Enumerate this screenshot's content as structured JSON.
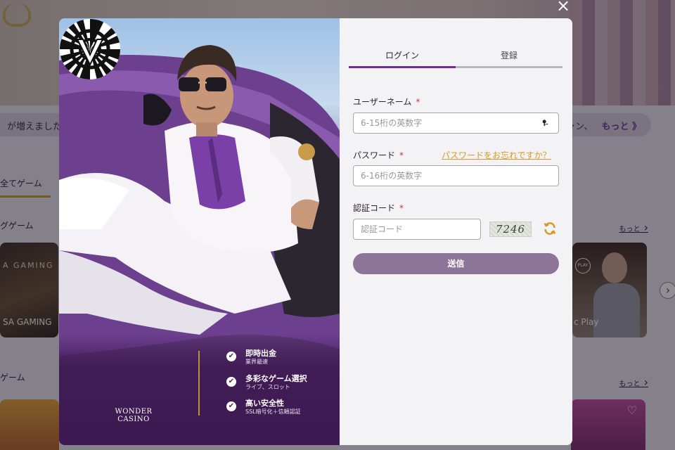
{
  "background": {
    "ticker_left": "が増えました",
    "ticker_right": "ャン、",
    "ticker_more": "もっと 》",
    "tab_all_games": "全てゲーム",
    "section1_title": "グゲーム",
    "section1_more": "もっと",
    "section2_title": "ゲーム",
    "section2_more": "もっと",
    "tile_left_top": "A GAMING",
    "tile_left_label": "SA GAMING",
    "tile_right_logo": "PLAY",
    "tile_right_label": "c Play",
    "carousel_next": "›",
    "heart": "♡"
  },
  "close_symbol": "×",
  "promo": {
    "brand_name": "WONDER CASINO",
    "features": [
      {
        "title": "即時出金",
        "sub": "業界最速"
      },
      {
        "title": "多彩なゲーム選択",
        "sub": "ライブ、スロット"
      },
      {
        "title": "高い安全性",
        "sub": "SSL暗号化＋信頼認証"
      }
    ],
    "check": "✔"
  },
  "form": {
    "tabs": [
      "ログイン",
      "登録"
    ],
    "active_tab": 0,
    "username_label": "ユーザーネーム",
    "username_placeholder": "6-15桁の英数字",
    "password_label": "パスワード",
    "forgot_link": "パスワードをお忘れですか？",
    "password_placeholder": "6-16桁の英数字",
    "captcha_label": "認証コード",
    "captcha_placeholder": "認証コード",
    "captcha_value": "7246",
    "required_mark": "*",
    "submit_label": "送信"
  },
  "colors": {
    "accent": "#6e2c96",
    "link": "#d59a24",
    "submit_bg": "#8d7597",
    "required": "#c23a3a"
  }
}
